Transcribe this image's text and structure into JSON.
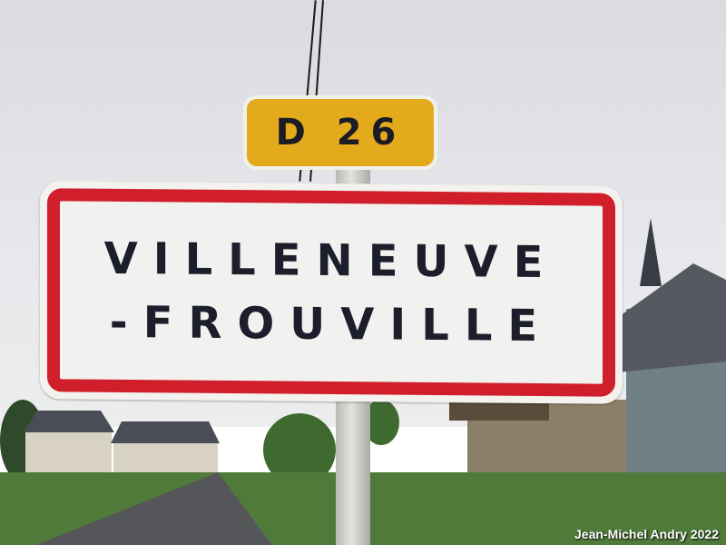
{
  "route_sign": {
    "text": "D 26"
  },
  "town_sign": {
    "line1": "VILLENEUVE",
    "line2": "-FROUVILLE"
  },
  "credit": "Jean-Michel Andry 2022",
  "colors": {
    "route_yellow": "#e3aa1c",
    "border_red": "#d01e2a",
    "text_dark": "#1d1e2c",
    "sky": "#e2e3e7"
  }
}
